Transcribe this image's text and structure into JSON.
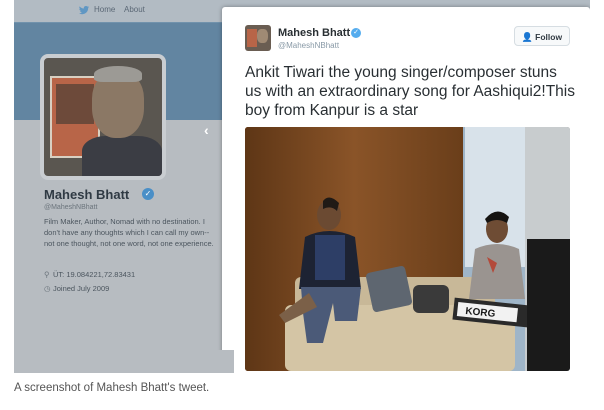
{
  "topbar": {
    "home_label": "Home",
    "about_label": "About"
  },
  "profile": {
    "name": "Mahesh Bhatt",
    "handle": "@MaheshNBhatt",
    "bio": "Film Maker, Author, Nomad with no destination. I don't have any thoughts which I can call my own--not one thought, not one word, not one experience.",
    "location": "ÜT: 19.084221,72.83431",
    "joined": "Joined July 2009"
  },
  "tweet": {
    "name": "Mahesh Bhatt",
    "handle": "@MaheshNBhatt",
    "follow_label": "Follow",
    "text": "Ankit Tiwari the young singer/composer stuns us with an extraordinary song for Aashiqui2!This boy from Kanpur is a star",
    "keyboard_brand": "KORG"
  },
  "caption": "A screenshot of Mahesh Bhatt's tweet.",
  "colors": {
    "twitter_blue": "#55acee",
    "tweet_text": "#292f33"
  }
}
